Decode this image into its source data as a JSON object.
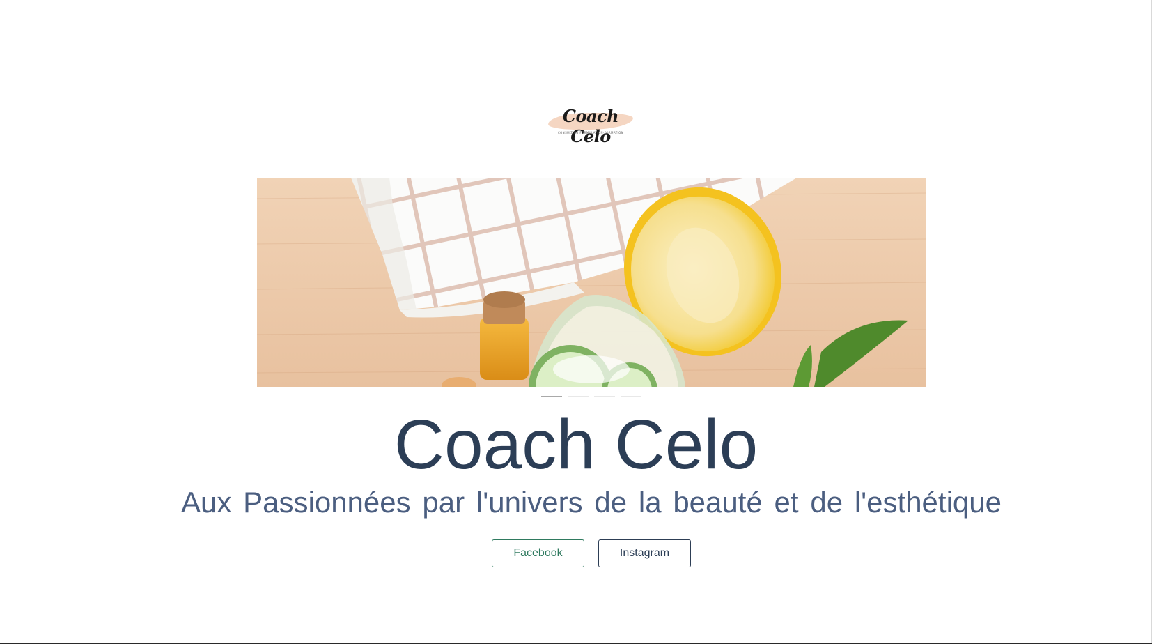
{
  "logo": {
    "script_text": "Coach Celo",
    "tagline": "CONSULTING·FORMULATION·FORMATION",
    "swash_color": "#f5d6c2"
  },
  "hero": {
    "image_description_icon": "hero-image",
    "slides_total": 4,
    "active_slide": 1
  },
  "main": {
    "title": "Coach Celo",
    "subtitle": "Aux Passionnées par l'univers de la beauté et de l'esthétique"
  },
  "buttons": {
    "facebook_label": "Facebook",
    "instagram_label": "Instagram"
  },
  "colors": {
    "title": "#2c3e56",
    "subtitle": "#4b5e80",
    "facebook_accent": "#2f7a5f"
  }
}
